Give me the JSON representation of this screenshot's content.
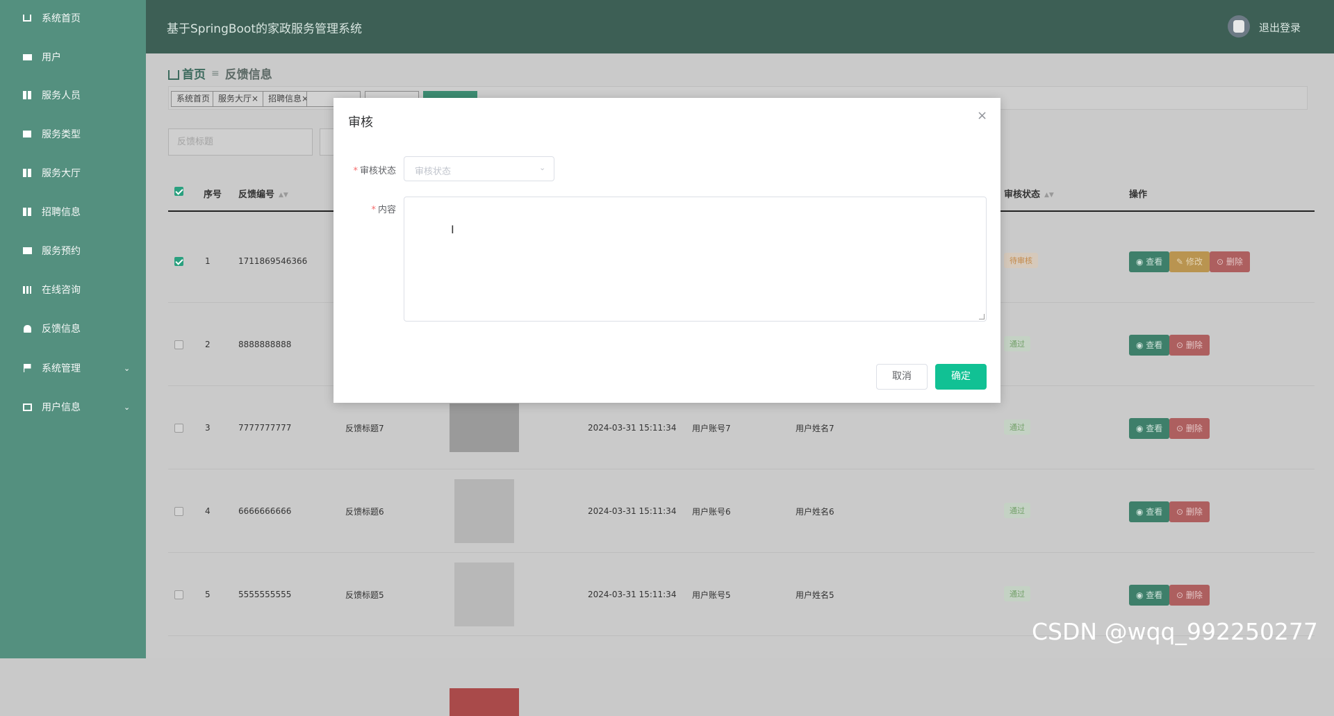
{
  "sidebar": {
    "items": [
      {
        "label": "系统首页",
        "icon": "home-icon"
      },
      {
        "label": "用户",
        "icon": "monitor-icon"
      },
      {
        "label": "服务人员",
        "icon": "grid-icon"
      },
      {
        "label": "服务类型",
        "icon": "chat-icon"
      },
      {
        "label": "服务大厅",
        "icon": "grid-icon"
      },
      {
        "label": "招聘信息",
        "icon": "grid-icon"
      },
      {
        "label": "服务预约",
        "icon": "briefcase-icon"
      },
      {
        "label": "在线咨询",
        "icon": "bar-chart-icon"
      },
      {
        "label": "反馈信息",
        "icon": "user-icon"
      },
      {
        "label": "系统管理",
        "icon": "flag-icon"
      },
      {
        "label": "用户信息",
        "icon": "card-icon"
      }
    ]
  },
  "header": {
    "title": "基于SpringBoot的家政服务管理系统",
    "logout": "退出登录"
  },
  "breadcrumb": {
    "home": "首页",
    "current": "反馈信息"
  },
  "tabs": [
    "系统首页",
    "服务大厅",
    "招聘信息",
    "",
    "",
    ""
  ],
  "tab_close": "×",
  "search": {
    "placeholder": "反馈标题"
  },
  "table": {
    "headers": {
      "index": "序号",
      "code": "反馈编号",
      "status": "审核状态",
      "actions": "操作"
    },
    "rows": [
      {
        "index": "1",
        "code": "1711869546366",
        "title": "",
        "time": "",
        "account": "",
        "name": "",
        "status": "待审核",
        "status_kind": "pend",
        "edit": true
      },
      {
        "index": "2",
        "code": "8888888888",
        "title": "",
        "time": "",
        "account": "",
        "name": "",
        "status": "通过",
        "status_kind": "pass",
        "edit": false
      },
      {
        "index": "3",
        "code": "7777777777",
        "title": "反馈标题7",
        "time": "2024-03-31 15:11:34",
        "account": "用户账号7",
        "name": "用户姓名7",
        "status": "通过",
        "status_kind": "pass",
        "edit": false
      },
      {
        "index": "4",
        "code": "6666666666",
        "title": "反馈标题6",
        "time": "2024-03-31 15:11:34",
        "account": "用户账号6",
        "name": "用户姓名6",
        "status": "通过",
        "status_kind": "pass",
        "edit": false
      },
      {
        "index": "5",
        "code": "5555555555",
        "title": "反馈标题5",
        "time": "2024-03-31 15:11:34",
        "account": "用户账号5",
        "name": "用户姓名5",
        "status": "通过",
        "status_kind": "pass",
        "edit": false
      }
    ],
    "btn_view": "查看",
    "btn_edit": "修改",
    "btn_delete": "删除"
  },
  "modal": {
    "title": "审核",
    "close": "×",
    "status_label": "审核状态",
    "status_placeholder": "审核状态",
    "content_label": "内容",
    "required": "*",
    "cancel": "取消",
    "confirm": "确定"
  },
  "watermark": "CSDN @wqq_992250277",
  "colors": {
    "sidebar": "#54907f",
    "header": "#3d5f55",
    "primary": "#11c194"
  }
}
